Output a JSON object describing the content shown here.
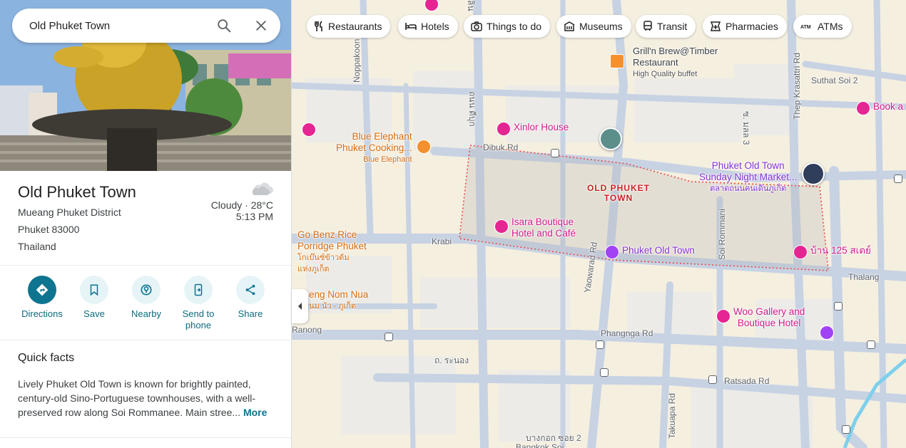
{
  "search": {
    "value": "Old Phuket Town"
  },
  "place": {
    "title": "Old Phuket Town",
    "address_lines": [
      "Mueang Phuket District",
      "Phuket 83000",
      "Thailand"
    ],
    "weather": {
      "condition_temp": "Cloudy · 28°C",
      "time": "5:13 PM"
    }
  },
  "actions": [
    {
      "label": "Directions",
      "icon": "directions-icon"
    },
    {
      "label": "Save",
      "icon": "bookmark-icon"
    },
    {
      "label": "Nearby",
      "icon": "nearby-icon"
    },
    {
      "label": "Send to",
      "label2": "phone",
      "icon": "send-to-phone-icon"
    },
    {
      "label": "Share",
      "icon": "share-icon"
    }
  ],
  "quick_facts": {
    "title": "Quick facts",
    "text": "Lively Phuket Old Town is known for brightly painted, century-old Sino-Portuguese townhouses, with a well-preserved row along Soi Rommanee. Main stree...",
    "more": "More"
  },
  "map": {
    "chips": [
      {
        "label": "Restaurants",
        "icon": "fork-knife-icon"
      },
      {
        "label": "Hotels",
        "icon": "bed-icon"
      },
      {
        "label": "Things to do",
        "icon": "camera-icon"
      },
      {
        "label": "Museums",
        "icon": "museum-icon"
      },
      {
        "label": "Transit",
        "icon": "train-icon"
      },
      {
        "label": "Pharmacies",
        "icon": "pharmacy-icon"
      },
      {
        "label": "ATMs",
        "icon": "atm-icon"
      }
    ],
    "area_label": [
      "OLD PHUKET",
      "TOWN"
    ],
    "pois": {
      "grill": {
        "name": "Grill'n Brew@Timber",
        "name2": "Restaurant",
        "sub": "High Quality buffet"
      },
      "xinlor": {
        "name": "Xinlor House"
      },
      "blue_elephant": {
        "name": "Blue Elephant",
        "name2": "Phuket Cooking...",
        "sub": "Blue Elephant"
      },
      "sunday_market": {
        "name": "Phuket Old Town",
        "name2": "Sunday Night Market...",
        "sub": "ตลาดถนนคนเดินภูเก็ต"
      },
      "isara": {
        "name": "Isara Boutique",
        "name2": "Hotel and Café"
      },
      "go_benz": {
        "name": "Go Benz Rice",
        "name2": "Porridge Phuket",
        "sub": "โกเบ๊นซ์ข้าวต้ม",
        "sub2": "แห่งภูเก็ต"
      },
      "phuket_old_town": {
        "name": "Phuket Old Town"
      },
      "ban125": {
        "name": "บ้าน 125 สเตย์"
      },
      "book": {
        "name": "Book a"
      },
      "teng": {
        "name": "eng Nom Nua",
        "sub": "นม นัว - ภูเก็ต"
      },
      "woo": {
        "name": "Woo Gallery and",
        "name2": "Boutique Hotel"
      }
    },
    "streets": {
      "dibuk": "Dibuk Rd",
      "krabi": "Krabi",
      "phangnga": "Phangnga Rd",
      "ratsada": "Ratsada Rd",
      "ranong": "Ranong",
      "yaowarad": "Yaowarad Rd",
      "soi_rommani": "Soi Rommani",
      "takuapa": "Takuapa Rd",
      "thep_krasattri": "Thep Krasattri Rd",
      "suthat": "Suthat Soi 2",
      "nipppakoon": "Noppakoon",
      "thalang": "Thalang",
      "thai_soi": "ซ. มลล 3",
      "thai_dibuk": "ถนน ดีบุก",
      "thai_ranong": "ถ. ระนอง",
      "bangkok_soi": "บางกอก ซอย 2",
      "bangkok": "Bangkok Soi",
      "thai_top": "ลิน"
    }
  },
  "colors": {
    "accent": "#0e7490",
    "area_border": "#e84a4a",
    "hotel_pin": "#e52592",
    "food_pin": "#f4902d"
  }
}
